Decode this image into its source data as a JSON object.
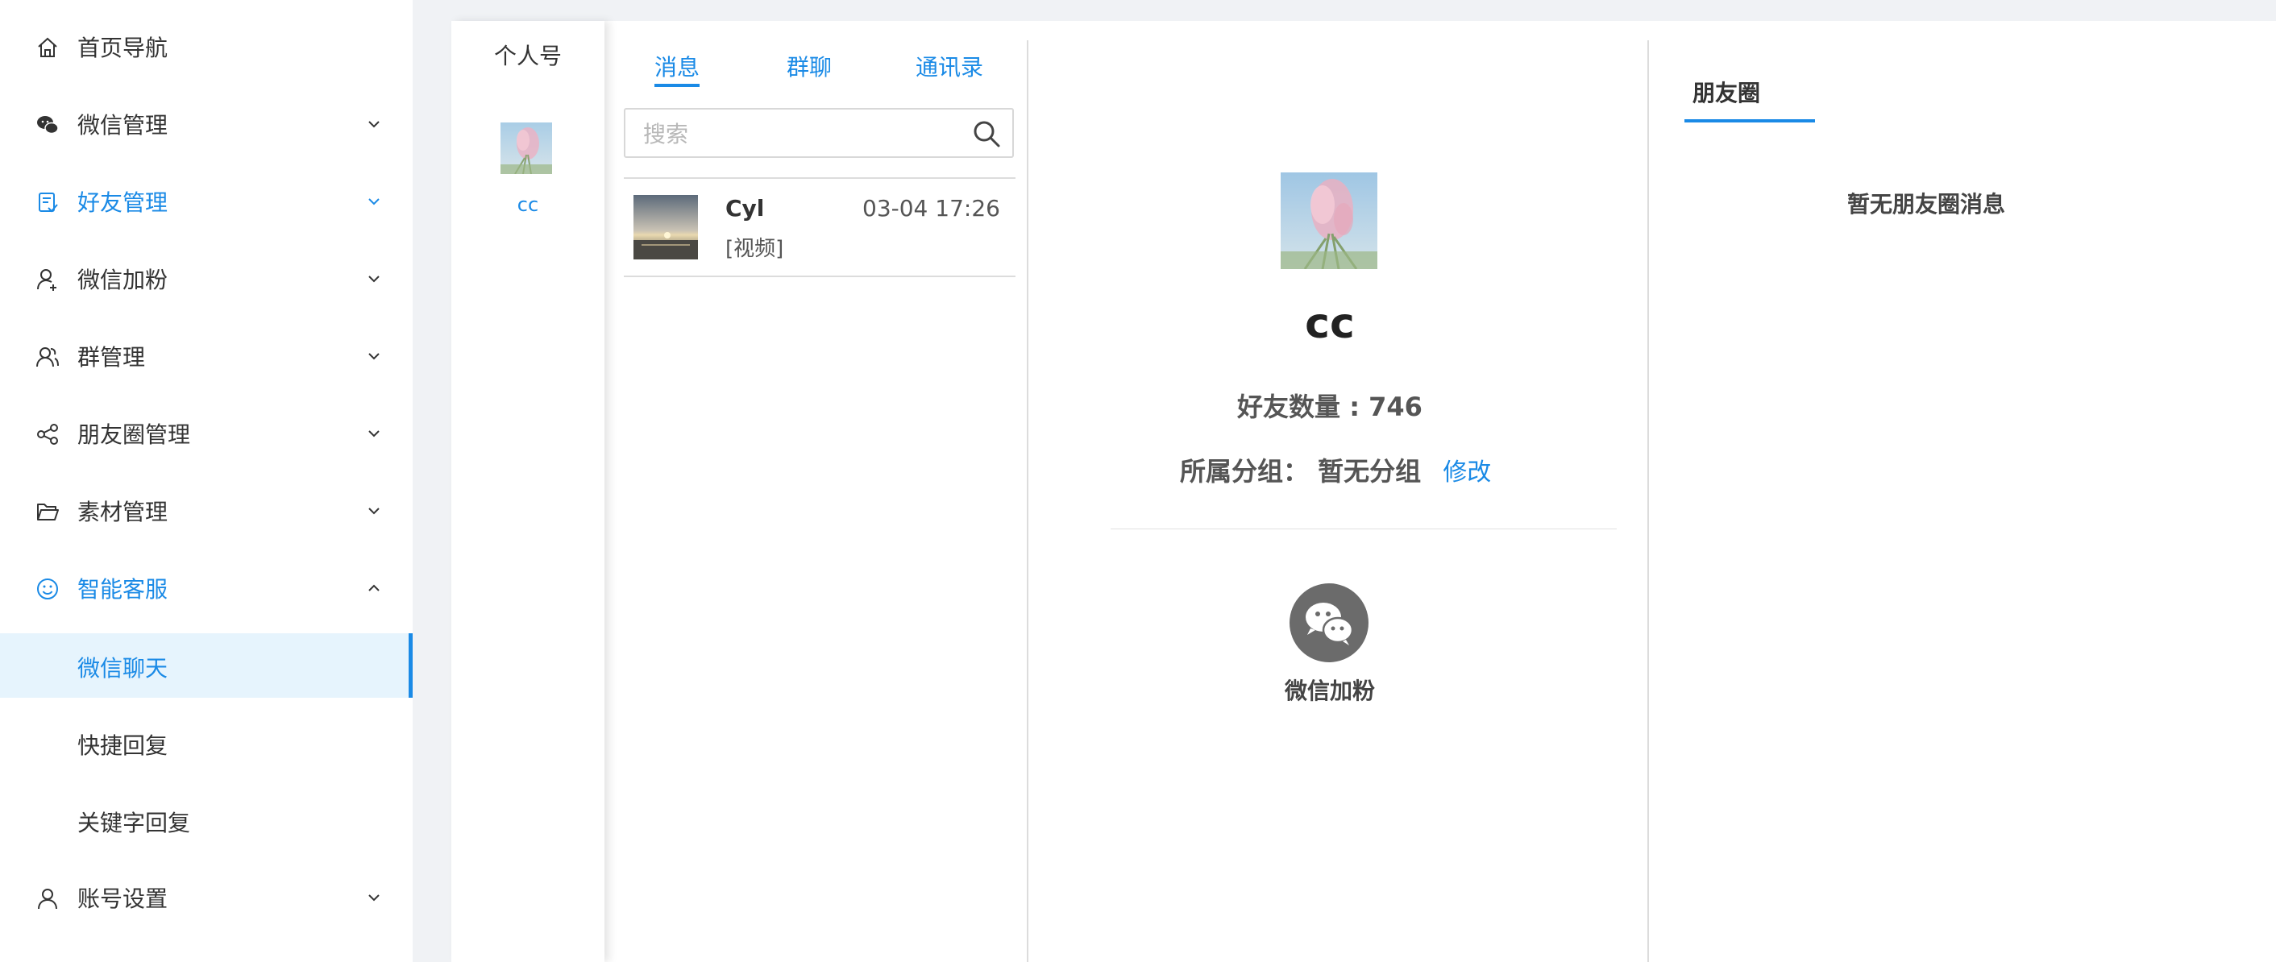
{
  "sidebar": {
    "items": [
      {
        "label": "首页导航",
        "icon": "home-icon"
      },
      {
        "label": "微信管理",
        "icon": "wechat-icon"
      },
      {
        "label": "好友管理",
        "icon": "contacts-icon"
      },
      {
        "label": "微信加粉",
        "icon": "add-user-icon"
      },
      {
        "label": "群管理",
        "icon": "group-icon"
      },
      {
        "label": "朋友圈管理",
        "icon": "share-icon"
      },
      {
        "label": "素材管理",
        "icon": "folder-icon"
      },
      {
        "label": "智能客服",
        "icon": "smile-icon"
      },
      {
        "label": "账号设置",
        "icon": "user-icon"
      }
    ],
    "sub_items": [
      {
        "label": "微信聊天"
      },
      {
        "label": "快捷回复"
      },
      {
        "label": "关键字回复"
      }
    ],
    "accent": "#1a8ae6"
  },
  "account": {
    "title": "个人号",
    "name": "cc"
  },
  "chat": {
    "tabs": [
      "消息",
      "群聊",
      "通讯录"
    ],
    "search_placeholder": "搜索",
    "items": [
      {
        "name": "Cyl",
        "time": "03-04 17:26",
        "preview": "[视频]"
      }
    ]
  },
  "profile": {
    "name": "cc",
    "friend_count_label": "好友数量 : 746",
    "group_label": "所属分组：",
    "group_value": "暂无分组",
    "edit_label": "修改",
    "action_label": "微信加粉"
  },
  "moments": {
    "tab_label": "朋友圈",
    "empty_text": "暂无朋友圈消息"
  }
}
